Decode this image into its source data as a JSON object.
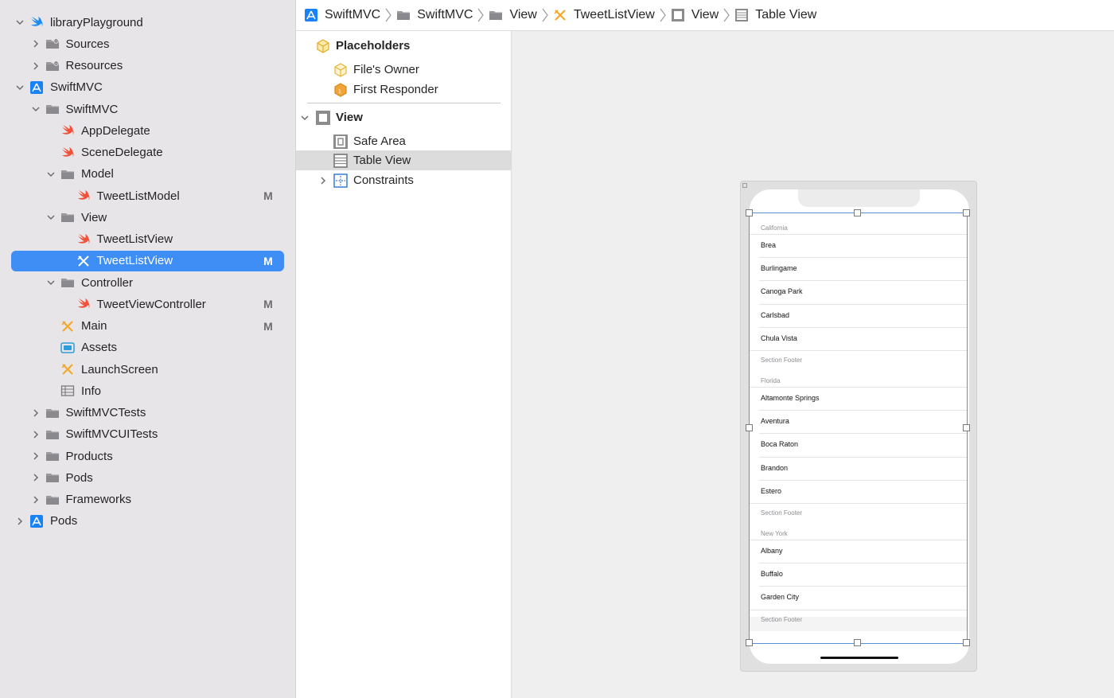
{
  "navigator": {
    "items": [
      {
        "label": "libraryPlayground",
        "icon": "swift-playground-icon",
        "badge": ""
      },
      {
        "label": "Sources",
        "icon": "folder-gear-icon",
        "badge": ""
      },
      {
        "label": "Resources",
        "icon": "folder-gear-icon",
        "badge": ""
      },
      {
        "label": "SwiftMVC",
        "icon": "xcode-project-icon",
        "badge": ""
      },
      {
        "label": "SwiftMVC",
        "icon": "folder-icon",
        "badge": ""
      },
      {
        "label": "AppDelegate",
        "icon": "swift-file-icon",
        "badge": ""
      },
      {
        "label": "SceneDelegate",
        "icon": "swift-file-icon",
        "badge": ""
      },
      {
        "label": "Model",
        "icon": "folder-icon",
        "badge": ""
      },
      {
        "label": "TweetListModel",
        "icon": "swift-file-icon",
        "badge": "M"
      },
      {
        "label": "View",
        "icon": "folder-icon",
        "badge": ""
      },
      {
        "label": "TweetListView",
        "icon": "swift-file-icon",
        "badge": ""
      },
      {
        "label": "TweetListView",
        "icon": "interface-builder-icon",
        "badge": "M"
      },
      {
        "label": "Controller",
        "icon": "folder-icon",
        "badge": ""
      },
      {
        "label": "TweetViewController",
        "icon": "swift-file-icon",
        "badge": "M"
      },
      {
        "label": "Main",
        "icon": "interface-builder-icon",
        "badge": "M"
      },
      {
        "label": "Assets",
        "icon": "asset-catalog-icon",
        "badge": ""
      },
      {
        "label": "LaunchScreen",
        "icon": "interface-builder-icon",
        "badge": ""
      },
      {
        "label": "Info",
        "icon": "plist-table-icon",
        "badge": ""
      },
      {
        "label": "SwiftMVCTests",
        "icon": "folder-icon",
        "badge": ""
      },
      {
        "label": "SwiftMVCUITests",
        "icon": "folder-icon",
        "badge": ""
      },
      {
        "label": "Products",
        "icon": "folder-icon",
        "badge": ""
      },
      {
        "label": "Pods",
        "icon": "folder-icon",
        "badge": ""
      },
      {
        "label": "Frameworks",
        "icon": "folder-icon",
        "badge": ""
      },
      {
        "label": "Pods",
        "icon": "xcode-project-icon",
        "badge": ""
      }
    ],
    "selected_index": 11
  },
  "jumpbar": {
    "crumbs": [
      {
        "label": "SwiftMVC",
        "icon": "xcode-project-icon"
      },
      {
        "label": "SwiftMVC",
        "icon": "folder-icon"
      },
      {
        "label": "View",
        "icon": "folder-icon"
      },
      {
        "label": "TweetListView",
        "icon": "interface-builder-icon"
      },
      {
        "label": "View",
        "icon": "view-icon"
      },
      {
        "label": "Table View",
        "icon": "table-view-icon"
      }
    ]
  },
  "outline": {
    "placeholders_label": "Placeholders",
    "files_owner_label": "File's Owner",
    "first_responder_label": "First Responder",
    "view_label": "View",
    "safe_area_label": "Safe Area",
    "table_view_label": "Table View",
    "constraints_label": "Constraints"
  },
  "tableview": {
    "sections": [
      {
        "header": "California",
        "rows": [
          "Brea",
          "Burlingame",
          "Canoga Park",
          "Carlsbad",
          "Chula Vista"
        ],
        "footer": "Section Footer"
      },
      {
        "header": "Florida",
        "rows": [
          "Altamonte Springs",
          "Aventura",
          "Boca Raton",
          "Brandon",
          "Estero"
        ],
        "footer": "Section Footer"
      },
      {
        "header": "New York",
        "rows": [
          "Albany",
          "Buffalo",
          "Garden City"
        ],
        "footer": "Section Footer"
      }
    ]
  },
  "colors": {
    "selection_blue": "#3e8ef5",
    "swift_orange": "#f05138",
    "ib_yellow": "#f5a623",
    "project_blue": "#1a82f7"
  }
}
